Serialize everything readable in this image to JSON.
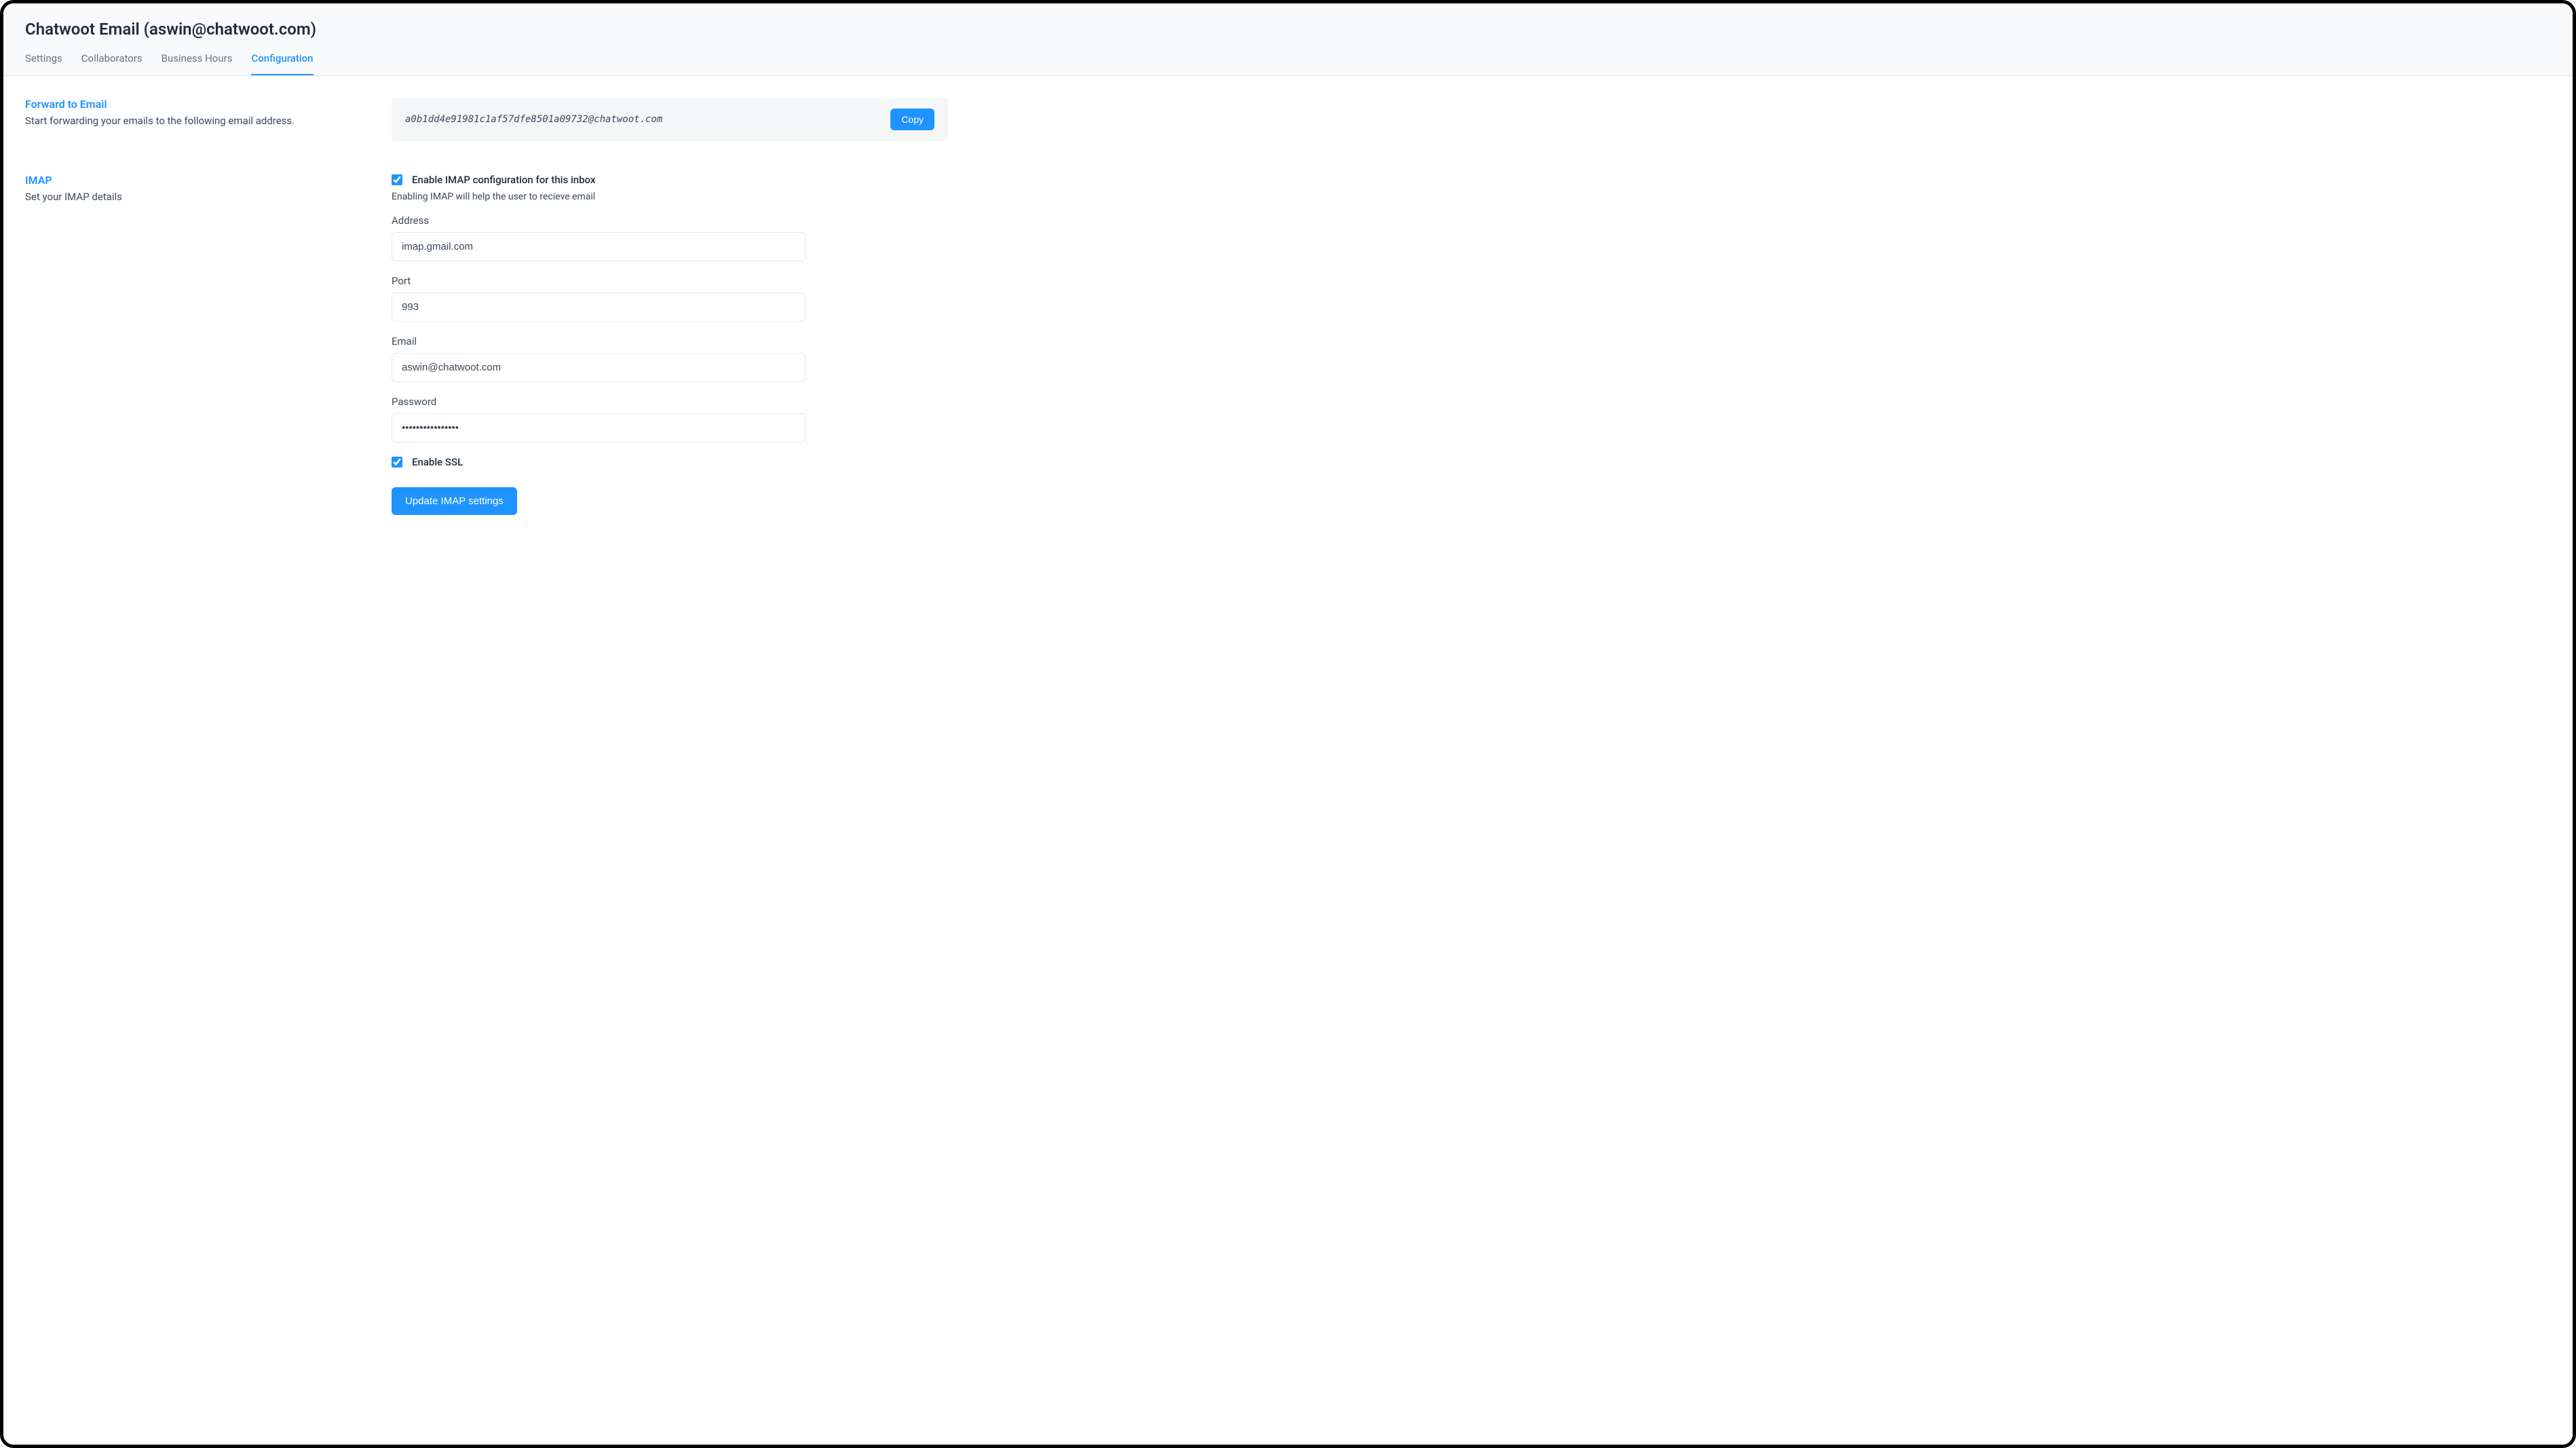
{
  "header": {
    "title": "Chatwoot Email (aswin@chatwoot.com)",
    "tabs": [
      {
        "label": "Settings",
        "active": false
      },
      {
        "label": "Collaborators",
        "active": false
      },
      {
        "label": "Business Hours",
        "active": false
      },
      {
        "label": "Configuration",
        "active": true
      }
    ]
  },
  "forward": {
    "title": "Forward to Email",
    "desc": "Start forwarding your emails to the following email address.",
    "email": "a0b1dd4e91981c1af57dfe8501a09732@chatwoot.com",
    "copy_label": "Copy"
  },
  "imap": {
    "title": "IMAP",
    "desc": "Set your IMAP details",
    "enable_label": "Enable IMAP configuration for this inbox",
    "enable_checked": true,
    "enable_hint": "Enabling IMAP will help the user to recieve email",
    "address_label": "Address",
    "address_value": "imap.gmail.com",
    "port_label": "Port",
    "port_value": "993",
    "email_label": "Email",
    "email_value": "aswin@chatwoot.com",
    "password_label": "Password",
    "password_value": "••••••••••••••••",
    "ssl_label": "Enable SSL",
    "ssl_checked": true,
    "submit_label": "Update IMAP settings"
  }
}
